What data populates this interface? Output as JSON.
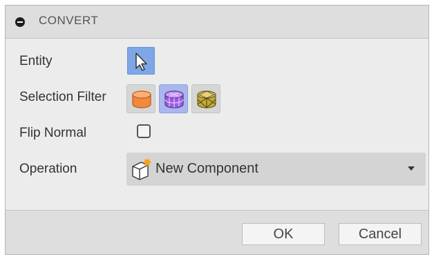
{
  "dialog": {
    "title": "CONVERT",
    "rows": {
      "entity": {
        "label": "Entity"
      },
      "selection_filter": {
        "label": "Selection Filter",
        "filters": [
          {
            "icon": "solid-body-icon",
            "color": "#f08a3c",
            "active": false
          },
          {
            "icon": "mesh-body-icon",
            "color": "#9b5ce0",
            "active": true
          },
          {
            "icon": "faceted-body-icon",
            "color": "#c2a93c",
            "active": false
          }
        ]
      },
      "flip_normal": {
        "label": "Flip Normal",
        "checked": false
      },
      "operation": {
        "label": "Operation",
        "value": "New Component",
        "icon": "new-component-icon"
      }
    },
    "buttons": {
      "ok": "OK",
      "cancel": "Cancel"
    }
  }
}
